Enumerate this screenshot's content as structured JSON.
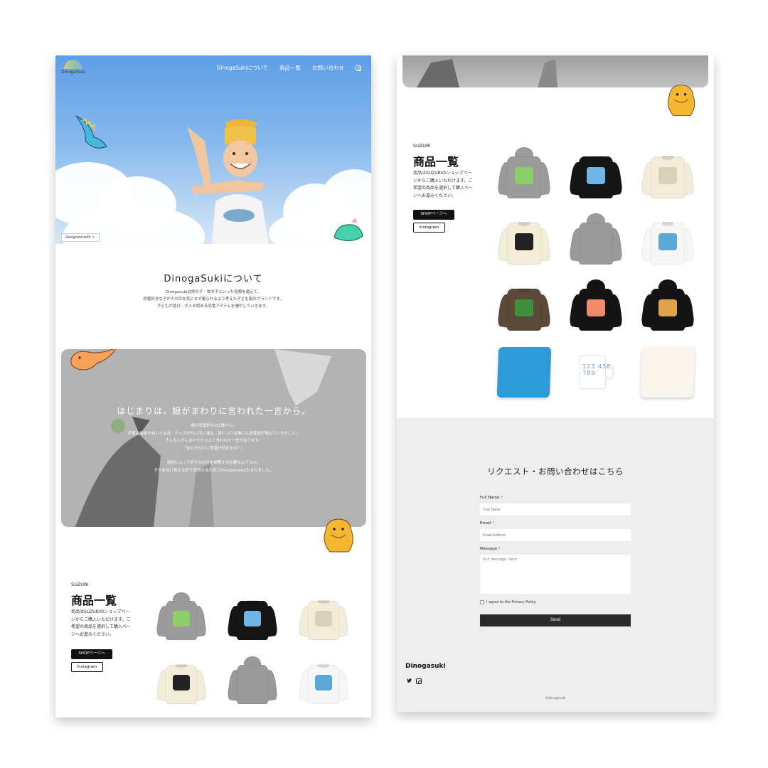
{
  "brand": {
    "logo_text": "DinogaSuki"
  },
  "nav": {
    "items": [
      "DinogaSukiについて",
      "商品一覧",
      "お問い合わせ"
    ],
    "instagram_icon": "instagram-icon"
  },
  "hero": {
    "badge": "Designed with"
  },
  "about": {
    "title": "DinogaSukiについて",
    "lines": [
      "Dinogasukiは男の子・女の子といった垣根を越えて、",
      "恐竜好きな子が人の目を気にせず着られるよう考えた子ども服のブランドです。",
      "子どもが喜び、大人が認める恐竜アイテムを増やしていきます。"
    ]
  },
  "story": {
    "title": "はじまりは、娘がまわりに言われた一言から。",
    "lines": [
      "娘の恐竜好きは2歳から。",
      "恐竜の絵本やぬいぐるみ、グッズが日に日に増え、身につける物にも恐竜柄が増えていきました。",
      "そんなときにまわりからよく言われた一言があります。",
      "「女の子なのに恐竜が好きなの？」",
      "",
      "性別によって好きなものを制限する必要なんてない。",
      "それを目に見える形で表現するためにDinogasukiは生まれました。"
    ]
  },
  "products": {
    "label": "SUZURI",
    "title": "商品一覧",
    "desc": "商品はSUZURIのショップページからご購入いただけます。ご希望の商品を選択して購入ページへお進みください。",
    "shop_button": "SHOPページへ",
    "instagram_button": "Instagram",
    "items": [
      {
        "kind": "hoodie",
        "color": "#9b9b9b",
        "print": "#8ccf6a"
      },
      {
        "kind": "sweat",
        "color": "#151515",
        "print": "#6fb6e6"
      },
      {
        "kind": "sweat",
        "color": "#f2ecd9",
        "print": "#d9d0b8"
      },
      {
        "kind": "sweat",
        "color": "#f2ecd9",
        "print": "#222222"
      },
      {
        "kind": "hoodie",
        "color": "#9a9a9a",
        "print": "#9a9a9a"
      },
      {
        "kind": "sweat",
        "color": "#f7f7f7",
        "print": "#5aa7d8"
      },
      {
        "kind": "sweat",
        "color": "#5b4a3a",
        "print": "#3f8f3f"
      },
      {
        "kind": "hoodie",
        "color": "#141414",
        "print": "#f08a6a"
      },
      {
        "kind": "hoodie",
        "color": "#141414",
        "print": "#e0a24a"
      },
      {
        "kind": "pillow",
        "color": "#2f9ad8"
      },
      {
        "kind": "mug",
        "color": "#ffffff",
        "text": "123 456 789"
      },
      {
        "kind": "pillow",
        "color": "#faf6ee"
      }
    ]
  },
  "contact": {
    "title": "リクエスト・お問い合わせはこちら",
    "name_label": "Full Name",
    "name_placeholder": "Your Name",
    "email_label": "Email",
    "email_placeholder": "Email Address",
    "message_label": "Message",
    "message_placeholder": "Put message here",
    "required_mark": "*",
    "agree_text": "I agree to the Privacy Policy.",
    "send_button": "Send"
  },
  "footer": {
    "brand": "Dinogasuki",
    "twitter_icon": "twitter-icon",
    "instagram_icon": "instagram-icon",
    "copyright": "©dinogasuki"
  }
}
